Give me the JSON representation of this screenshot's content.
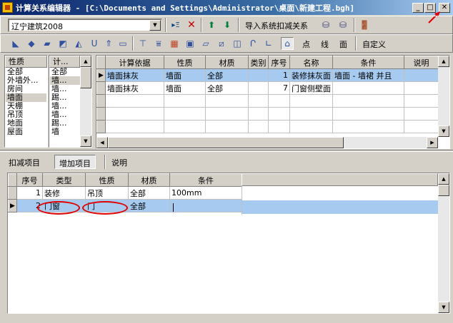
{
  "window": {
    "title": "计算关系编辑器 - [C:\\Documents and Settings\\Administrator\\桌面\\新建工程.bgh]"
  },
  "toolbar": {
    "region_select": "辽宁建筑2008",
    "import_label": "导入系统扣减关系",
    "point_label": "点",
    "line_label": "线",
    "face_label": "面",
    "custom_label": "自定义"
  },
  "left_lists": {
    "property_header": "性质",
    "properties": [
      "全部",
      "外墙外...",
      "房间",
      "墙面",
      "天棚",
      "吊顶",
      "地面",
      "屋面"
    ],
    "basis_header": "计...",
    "basis_items": [
      "全部",
      "墙...",
      "墙...",
      "踢...",
      "墙...",
      "墙...",
      "踢...",
      "墙"
    ]
  },
  "top_grid": {
    "headers": [
      "计算依据",
      "性质",
      "材质",
      "类别",
      "序号",
      "名称",
      "条件",
      "说明"
    ],
    "rows": [
      {
        "basis": "墙面抹灰",
        "property": "墙面",
        "material": "全部",
        "category": "",
        "seq": "1",
        "name": "装修抹灰面",
        "condition": "墙面 - 墙裙 并且",
        "note": ""
      },
      {
        "basis": "墙面抹灰",
        "property": "墙面",
        "material": "全部",
        "category": "",
        "seq": "7",
        "name": "门窗侧壁面",
        "condition": "",
        "note": ""
      }
    ]
  },
  "tabs": [
    "扣减项目",
    "增加项目",
    "说明"
  ],
  "bottom_grid": {
    "headers": [
      "序号",
      "类型",
      "性质",
      "材质",
      "条件"
    ],
    "rows": [
      {
        "seq": "1",
        "type": "装修",
        "property": "吊顶",
        "material": "全部",
        "condition": "100mm"
      },
      {
        "seq": "2",
        "type": "门窗",
        "property": "门",
        "material": "全部",
        "condition": ""
      }
    ]
  },
  "colors": {
    "face": "#d4d0c8",
    "selection": "#a6caf0",
    "title_start": "#0a246a",
    "annotation": "#e00000"
  }
}
